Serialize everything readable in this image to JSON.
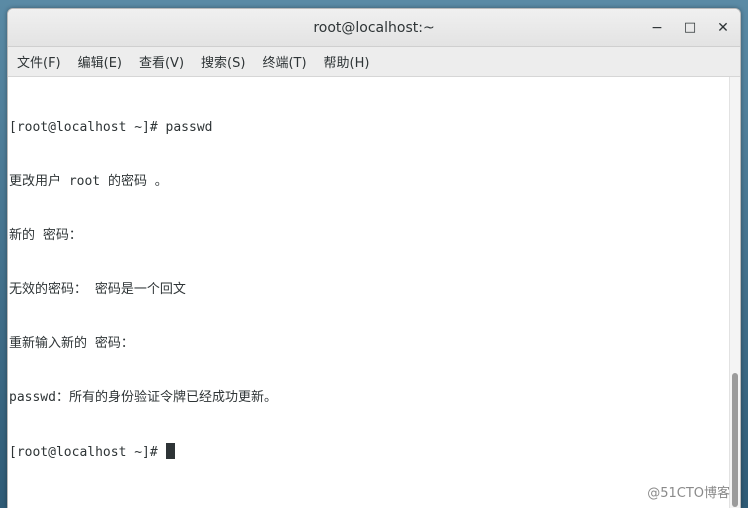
{
  "window": {
    "title": "root@localhost:~",
    "controls": {
      "minimize": "−",
      "maximize": "□",
      "close": "✕"
    }
  },
  "menu": {
    "items": [
      {
        "label": "文件(F)"
      },
      {
        "label": "编辑(E)"
      },
      {
        "label": "查看(V)"
      },
      {
        "label": "搜索(S)"
      },
      {
        "label": "终端(T)"
      },
      {
        "label": "帮助(H)"
      }
    ]
  },
  "terminal": {
    "lines": [
      "[root@localhost ~]# passwd",
      "更改用户 root 的密码 。",
      "新的 密码：",
      "无效的密码： 密码是一个回文",
      "重新输入新的 密码：",
      "passwd：所有的身份验证令牌已经成功更新。"
    ],
    "prompt": "[root@localhost ~]# "
  },
  "watermark": "@51CTO博客"
}
